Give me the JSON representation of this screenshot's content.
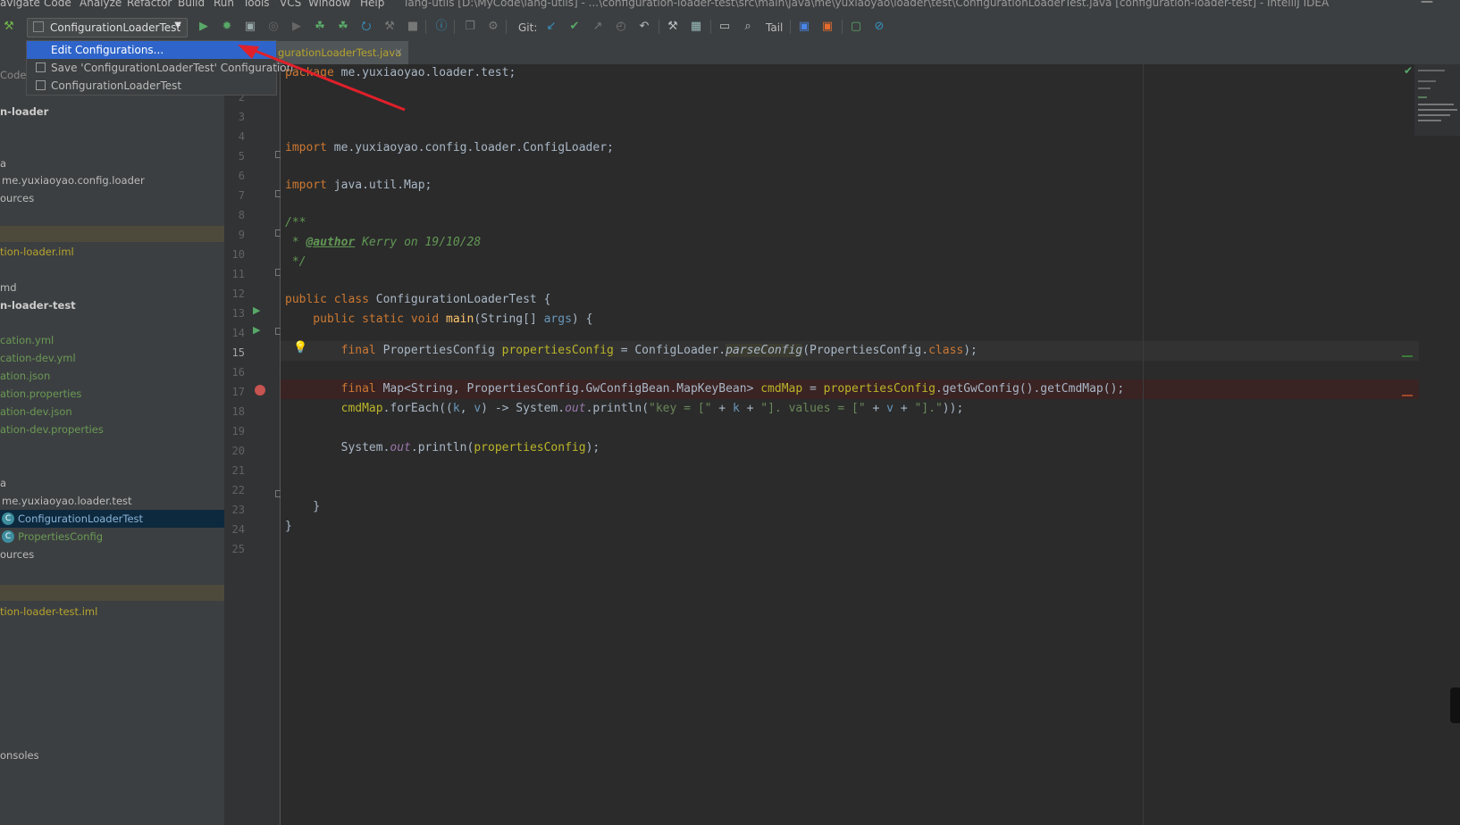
{
  "menu": {
    "items": [
      "avigate",
      "Code",
      "Analyze",
      "Refactor",
      "Build",
      "Run",
      "Tools",
      "VCS",
      "Window",
      "Help"
    ],
    "title": "lang-utils [D:\\MyCode\\lang-utils] - ...\\configuration-loader-test\\src\\main\\java\\me\\yuxiaoyao\\loader\\test\\ConfigurationLoaderTest.java [configuration-loader-test] - IntelliJ IDEA"
  },
  "toolbar": {
    "run_config": "ConfigurationLoaderTest",
    "git_label": "Git:",
    "tail_label": "Tail"
  },
  "dropdown": {
    "items": [
      {
        "label": "Edit Configurations...",
        "selected": true
      },
      {
        "label": "Save 'ConfigurationLoaderTest' Configuration",
        "selected": false
      },
      {
        "label": "ConfigurationLoaderTest",
        "selected": false
      }
    ]
  },
  "project": {
    "header": "Code",
    "rows": [
      {
        "text": "n-loader",
        "style": "bold"
      },
      {
        "text": "a",
        "style": "plain"
      },
      {
        "text": "me.yuxiaoyao.config.loader",
        "style": "plain"
      },
      {
        "text": "ources",
        "style": "plain"
      },
      {
        "text": "tion-loader.iml",
        "style": "yellow"
      },
      {
        "text": "md",
        "style": "plain"
      },
      {
        "text": "n-loader-test",
        "style": "bold"
      },
      {
        "text": "cation.yml",
        "style": "green"
      },
      {
        "text": "cation-dev.yml",
        "style": "green"
      },
      {
        "text": "ation.json",
        "style": "green"
      },
      {
        "text": "ation.properties",
        "style": "green"
      },
      {
        "text": "ation-dev.json",
        "style": "green"
      },
      {
        "text": "ation-dev.properties",
        "style": "green"
      },
      {
        "text": "a",
        "style": "plain"
      },
      {
        "text": "me.yuxiaoyao.loader.test",
        "style": "plain"
      },
      {
        "text": "ConfigurationLoaderTest",
        "style": "selected"
      },
      {
        "text": "PropertiesConfig",
        "style": "green"
      },
      {
        "text": "ources",
        "style": "plain"
      },
      {
        "text": "tion-loader-test.iml",
        "style": "yellow"
      },
      {
        "text": "onsoles",
        "style": "plain"
      }
    ]
  },
  "tab": {
    "file": "gurationLoaderTest.java",
    "close": "×"
  },
  "editor": {
    "line_numbers": [
      "2",
      "3",
      "4",
      "5",
      "6",
      "7",
      "8",
      "9",
      "10",
      "11",
      "12",
      "13",
      "14",
      "15",
      "16",
      "17",
      "18",
      "19",
      "20",
      "21",
      "22",
      "23",
      "24",
      "25"
    ],
    "current_line": "15",
    "package_kw": "package",
    "package_name": " me.yuxiaoyao.loader.test;",
    "import1_kw": "import",
    "import1": " me.yuxiaoyao.config.loader.ConfigLoader;",
    "import2_kw": "import",
    "import2": " java.util.Map;",
    "doc_open": "/**",
    "doc_star": " * ",
    "doc_tag": "@author",
    "doc_text": " Kerry on 19/10/28",
    "doc_close": " */",
    "l13_kw": "public class",
    "l13_rest": " ConfigurationLoaderTest {",
    "l14_kw": "    public static void",
    "l14_main": " main",
    "l14_a": "(String[] ",
    "l14_args": "args",
    "l14_b": ") {",
    "l15_kw": "        final",
    "l15_a": " PropertiesConfig ",
    "l15_var": "propertiesConfig",
    "l15_b": " = ConfigLoader.",
    "l15_call": "parseConfig",
    "l15_c": "(PropertiesConfig.",
    "l15_class": "class",
    "l15_d": ");",
    "l17_kw": "        final",
    "l17_a": " Map<String, PropertiesConfig.GwConfigBean.MapKeyBean> ",
    "l17_var": "cmdMap",
    "l17_b": " = ",
    "l17_var2": "propertiesConfig",
    "l17_c": ".getGwConfig().getCmdMap();",
    "l18_var": "        cmdMap",
    "l18_a": ".forEach((",
    "l18_k": "k",
    "l18_b": ", ",
    "l18_v": "v",
    "l18_c": ") -> System.",
    "l18_out": "out",
    "l18_d": ".println(",
    "l18_s1": "\"key = [\"",
    "l18_e": " + ",
    "l18_k2": "k",
    "l18_f": " + ",
    "l18_s2": "\"]. values = [\"",
    "l18_g": " + ",
    "l18_v2": "v",
    "l18_h": " + ",
    "l18_s3": "\"].\"",
    "l18_i": "));",
    "l20_a": "        System.",
    "l20_out": "out",
    "l20_b": ".println(",
    "l20_var": "propertiesConfig",
    "l20_c": ");",
    "l23": "    }",
    "l24": "}"
  },
  "colors": {
    "accent_selection": "#2f65ca",
    "annotation_arrow": "#e0202a",
    "breakpoint": "#c75450"
  }
}
